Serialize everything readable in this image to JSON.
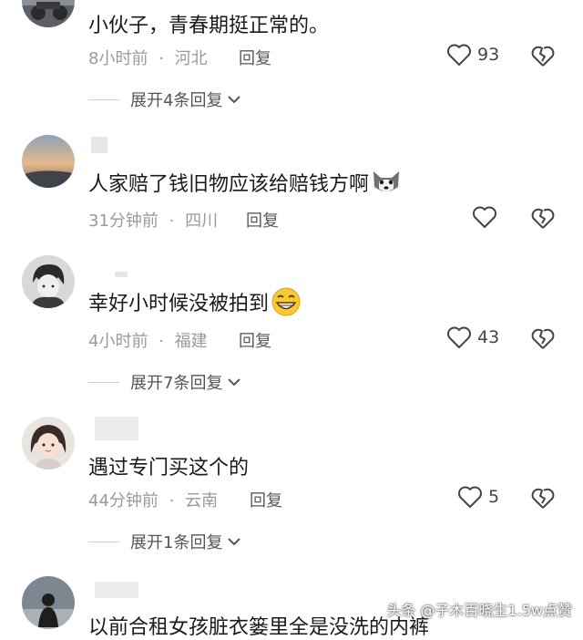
{
  "comments": [
    {
      "text": "小伙子，青春期挺正常的。",
      "time": "8小时前",
      "location": "河北",
      "reply_label": "回复",
      "likes": "93",
      "expand_label": "展开4条回复",
      "avatar_icon": "motorcycle-avatar"
    },
    {
      "text": "人家赔了钱旧物应该给赔钱方啊",
      "emoji": "husky-emoji",
      "time": "31分钟前",
      "location": "四川",
      "reply_label": "回复",
      "likes": "",
      "avatar_icon": "sunset-avatar"
    },
    {
      "text": "幸好小时候没被拍到",
      "emoji": "grin-emoji",
      "time": "4小时前",
      "location": "福建",
      "reply_label": "回复",
      "likes": "43",
      "expand_label": "展开7条回复",
      "avatar_icon": "anime-boy-avatar"
    },
    {
      "text": "遇过专门买这个的",
      "time": "44分钟前",
      "location": "云南",
      "reply_label": "回复",
      "likes": "5",
      "expand_label": "展开1条回复",
      "avatar_icon": "girl-avatar"
    },
    {
      "text": "以前合租女孩脏衣篓里全是没洗的内裤",
      "avatar_icon": "silhouette-avatar"
    }
  ],
  "meta_separator": "·",
  "watermark": "头条 @子木百晓生1.5w点赞",
  "colors": {
    "meta": "#9a9a9a",
    "heart_stroke": "#444444"
  }
}
